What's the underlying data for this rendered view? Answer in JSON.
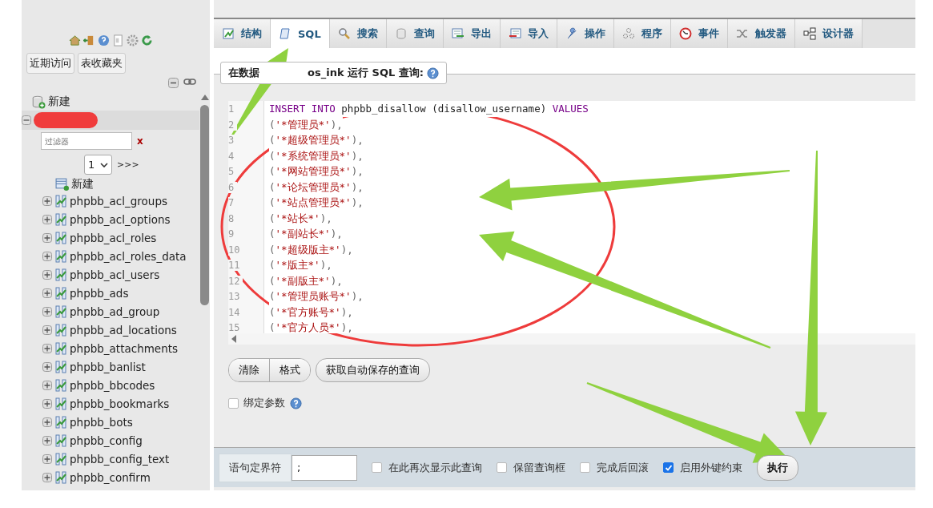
{
  "nav": {
    "buttons": [
      "近期访问",
      "表收藏夹"
    ],
    "new_db": "新建",
    "filter": {
      "placeholder": "过滤器",
      "clear": "x"
    },
    "page": {
      "value": "1",
      "next": ">>>"
    },
    "new_table": "新建",
    "tables": [
      "phpbb_acl_groups",
      "phpbb_acl_options",
      "phpbb_acl_roles",
      "phpbb_acl_roles_data",
      "phpbb_acl_users",
      "phpbb_ads",
      "phpbb_ad_group",
      "phpbb_ad_locations",
      "phpbb_attachments",
      "phpbb_banlist",
      "phpbb_bbcodes",
      "phpbb_bookmarks",
      "phpbb_bots",
      "phpbb_config",
      "phpbb_config_text",
      "phpbb_confirm"
    ]
  },
  "tabs": [
    {
      "label": "结构",
      "kind": "structure",
      "selected": false
    },
    {
      "label": "SQL",
      "kind": "sql",
      "selected": true
    },
    {
      "label": "搜索",
      "kind": "search",
      "selected": false
    },
    {
      "label": "查询",
      "kind": "query",
      "selected": false
    },
    {
      "label": "导出",
      "kind": "export",
      "selected": false
    },
    {
      "label": "导入",
      "kind": "import",
      "selected": false
    },
    {
      "label": "操作",
      "kind": "operations",
      "selected": false
    },
    {
      "label": "程序",
      "kind": "routines",
      "selected": false
    },
    {
      "label": "事件",
      "kind": "events",
      "selected": false
    },
    {
      "label": "触发器",
      "kind": "triggers",
      "selected": false
    },
    {
      "label": "设计器",
      "kind": "designer",
      "selected": false
    }
  ],
  "query": {
    "legend": [
      "在数据",
      "os_ink 运行 SQL 查询:"
    ],
    "lines": [
      {
        "number": "1",
        "tokens": [
          {
            "kind": "keyword",
            "text": "INSERT INTO"
          },
          {
            "kind": "name",
            "text": "phpbb_disallow (disallow_username)"
          },
          {
            "kind": "keyword",
            "text": "VALUES"
          }
        ]
      },
      {
        "number": "2",
        "tokens": [
          {
            "kind": "punct",
            "text": "("
          },
          {
            "kind": "string",
            "text": "'*管理员*'"
          },
          {
            "kind": "punct",
            "text": "),"
          }
        ]
      },
      {
        "number": "3",
        "tokens": [
          {
            "kind": "punct",
            "text": "("
          },
          {
            "kind": "string",
            "text": "'*超级管理员*'"
          },
          {
            "kind": "punct",
            "text": "),"
          }
        ]
      },
      {
        "number": "4",
        "tokens": [
          {
            "kind": "punct",
            "text": "("
          },
          {
            "kind": "string",
            "text": "'*系统管理员*'"
          },
          {
            "kind": "punct",
            "text": "),"
          }
        ]
      },
      {
        "number": "5",
        "tokens": [
          {
            "kind": "punct",
            "text": "("
          },
          {
            "kind": "string",
            "text": "'*网站管理员*'"
          },
          {
            "kind": "punct",
            "text": "),"
          }
        ]
      },
      {
        "number": "6",
        "tokens": [
          {
            "kind": "punct",
            "text": "("
          },
          {
            "kind": "string",
            "text": "'*论坛管理员*'"
          },
          {
            "kind": "punct",
            "text": "),"
          }
        ]
      },
      {
        "number": "7",
        "tokens": [
          {
            "kind": "punct",
            "text": "("
          },
          {
            "kind": "string",
            "text": "'*站点管理员*'"
          },
          {
            "kind": "punct",
            "text": "),"
          }
        ]
      },
      {
        "number": "8",
        "tokens": [
          {
            "kind": "punct",
            "text": "("
          },
          {
            "kind": "string",
            "text": "'*站长*'"
          },
          {
            "kind": "punct",
            "text": "),"
          }
        ]
      },
      {
        "number": "9",
        "tokens": [
          {
            "kind": "punct",
            "text": "("
          },
          {
            "kind": "string",
            "text": "'*副站长*'"
          },
          {
            "kind": "punct",
            "text": "),"
          }
        ]
      },
      {
        "number": "10",
        "tokens": [
          {
            "kind": "punct",
            "text": "("
          },
          {
            "kind": "string",
            "text": "'*超级版主*'"
          },
          {
            "kind": "punct",
            "text": "),"
          }
        ]
      },
      {
        "number": "11",
        "tokens": [
          {
            "kind": "punct",
            "text": "("
          },
          {
            "kind": "string",
            "text": "'*版主*'"
          },
          {
            "kind": "punct",
            "text": "),"
          }
        ]
      },
      {
        "number": "12",
        "tokens": [
          {
            "kind": "punct",
            "text": "("
          },
          {
            "kind": "string",
            "text": "'*副版主*'"
          },
          {
            "kind": "punct",
            "text": "),"
          }
        ]
      },
      {
        "number": "13",
        "tokens": [
          {
            "kind": "punct",
            "text": "("
          },
          {
            "kind": "string",
            "text": "'*管理员账号*'"
          },
          {
            "kind": "punct",
            "text": "),"
          }
        ]
      },
      {
        "number": "14",
        "tokens": [
          {
            "kind": "punct",
            "text": "("
          },
          {
            "kind": "string",
            "text": "'*官方账号*'"
          },
          {
            "kind": "punct",
            "text": "),"
          }
        ]
      },
      {
        "number": "15",
        "tokens": [
          {
            "kind": "punct",
            "text": "("
          },
          {
            "kind": "string",
            "text": "'*官方人员*'"
          },
          {
            "kind": "punct",
            "text": "),"
          }
        ]
      }
    ]
  },
  "editor_buttons": [
    "清除",
    "格式"
  ],
  "autosave": "获取自动保存的查询",
  "bind": {
    "label": "绑定参数",
    "checked": false
  },
  "footer": {
    "delimiter_label": "语句定界符",
    "delimiter": ";",
    "options": [
      {
        "label": "在此再次显示此查询",
        "checked": false
      },
      {
        "label": "保留查询框",
        "checked": false
      },
      {
        "label": "完成后回滚",
        "checked": false
      },
      {
        "label": "启用外键约束",
        "checked": true
      }
    ],
    "go": "执行"
  }
}
